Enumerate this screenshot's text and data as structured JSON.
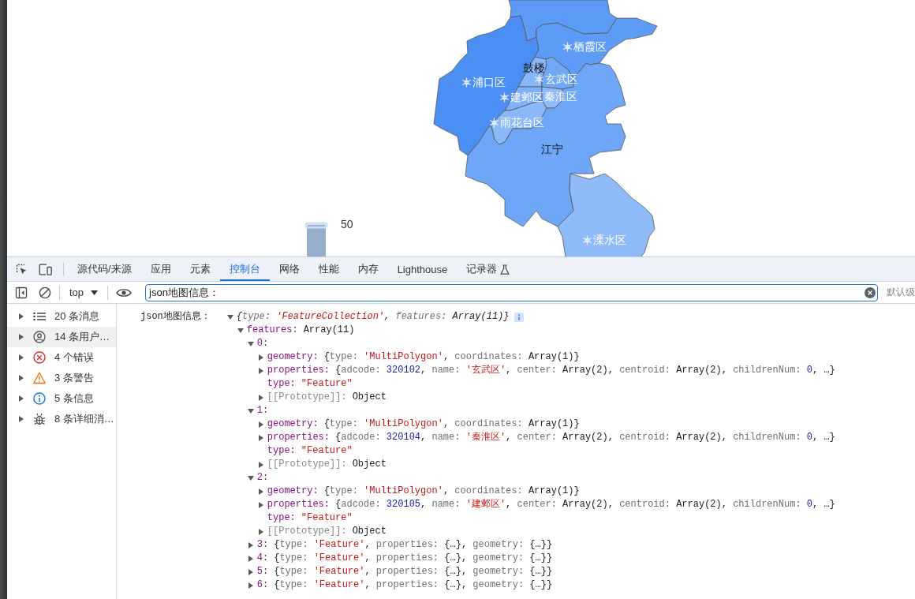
{
  "map": {
    "regions": [
      {
        "color": "#5b9bf6"
      },
      {
        "color": "#4b8ff5"
      },
      {
        "color": "#5c9cf6"
      },
      {
        "color": "#87b7f8"
      },
      {
        "color": "#6fa8f7"
      },
      {
        "color": "#7db1f8"
      },
      {
        "color": "#8dbaf8"
      },
      {
        "color": "#8ab8f8"
      },
      {
        "color": "#6ea7f7"
      },
      {
        "color": "#8fbbf8"
      }
    ],
    "labels": [
      {
        "text": "栖霞区",
        "kind": "marker",
        "icon": true
      },
      {
        "text": "浦口区",
        "kind": "marker",
        "icon": true
      },
      {
        "text": "鼓楼",
        "kind": "name",
        "icon": false
      },
      {
        "text": "玄武区",
        "kind": "marker",
        "icon": true
      },
      {
        "text": "建邺区",
        "kind": "marker",
        "icon": true
      },
      {
        "text": "秦淮区",
        "kind": "marker",
        "icon": false
      },
      {
        "text": "雨花台区",
        "kind": "marker",
        "icon": true
      },
      {
        "text": "江宁",
        "kind": "name",
        "icon": false
      },
      {
        "text": "溧水区",
        "kind": "marker",
        "icon": true
      }
    ],
    "visual_map": {
      "handle_value": "50"
    }
  },
  "devtools": {
    "tabs": [
      {
        "label": "源代码/来源",
        "selected": false,
        "experimental": false
      },
      {
        "label": "应用",
        "selected": false,
        "experimental": false
      },
      {
        "label": "元素",
        "selected": false,
        "experimental": false
      },
      {
        "label": "控制台",
        "selected": true,
        "experimental": false
      },
      {
        "label": "网络",
        "selected": false,
        "experimental": false
      },
      {
        "label": "性能",
        "selected": false,
        "experimental": false
      },
      {
        "label": "内存",
        "selected": false,
        "experimental": false
      },
      {
        "label": "Lighthouse",
        "selected": false,
        "experimental": false
      },
      {
        "label": "记录器",
        "selected": false,
        "experimental": true
      }
    ],
    "toolbar": {
      "context": "top",
      "filter": {
        "value": "json地图信息："
      },
      "levels": "默认级"
    },
    "sidebar": [
      {
        "label": "20 条消息",
        "kind": "all",
        "selected": false,
        "expanded": false
      },
      {
        "label": "14 条用户…",
        "kind": "user",
        "selected": true,
        "expanded": false
      },
      {
        "label": "4 个错误",
        "kind": "error",
        "selected": false,
        "expanded": false
      },
      {
        "label": "3 条警告",
        "kind": "warning",
        "selected": false,
        "expanded": false
      },
      {
        "label": "5 条信息",
        "kind": "info",
        "selected": false,
        "expanded": false
      },
      {
        "label": "8 条详细消…",
        "kind": "verbose",
        "selected": false,
        "expanded": false
      }
    ],
    "console": {
      "message": "json地图信息：",
      "tree": {
        "kind": "root",
        "expanded": true,
        "parts": [
          {
            "kind": "plain",
            "text": "{"
          },
          {
            "kind": "name",
            "text": "type: "
          },
          {
            "kind": "string",
            "text": "'FeatureCollection'"
          },
          {
            "kind": "plain",
            "text": ", "
          },
          {
            "kind": "name",
            "text": "features: "
          },
          {
            "kind": "plain",
            "text": "Array(11)}"
          }
        ],
        "children": [
          {
            "kind": "branch",
            "key": "features:",
            "expanded": true,
            "parts": [
              {
                "kind": "plain",
                "text": "Array(11)"
              }
            ],
            "children": [
              {
                "kind": "branch",
                "key": "0:",
                "expanded": true,
                "children": [
                  {
                    "kind": "branch",
                    "key": "geometry:",
                    "expanded": false,
                    "parts": [
                      {
                        "kind": "plain",
                        "text": "{"
                      },
                      {
                        "kind": "name",
                        "text": "type: "
                      },
                      {
                        "kind": "string",
                        "text": "'MultiPolygon'"
                      },
                      {
                        "kind": "plain",
                        "text": ", "
                      },
                      {
                        "kind": "name",
                        "text": "coordinates: "
                      },
                      {
                        "kind": "plain",
                        "text": "Array(1)}"
                      }
                    ]
                  },
                  {
                    "kind": "branch",
                    "key": "properties:",
                    "expanded": false,
                    "parts": [
                      {
                        "kind": "plain",
                        "text": "{"
                      },
                      {
                        "kind": "name",
                        "text": "adcode: "
                      },
                      {
                        "kind": "number",
                        "text": "320102"
                      },
                      {
                        "kind": "plain",
                        "text": ", "
                      },
                      {
                        "kind": "name",
                        "text": "name: "
                      },
                      {
                        "kind": "string",
                        "text": "'玄武区'"
                      },
                      {
                        "kind": "plain",
                        "text": ", "
                      },
                      {
                        "kind": "name",
                        "text": "center: "
                      },
                      {
                        "kind": "plain",
                        "text": "Array(2), "
                      },
                      {
                        "kind": "name",
                        "text": "centroid: "
                      },
                      {
                        "kind": "plain",
                        "text": "Array(2), "
                      },
                      {
                        "kind": "name",
                        "text": "childrenNum: "
                      },
                      {
                        "kind": "number",
                        "text": "0"
                      },
                      {
                        "kind": "plain",
                        "text": ", …}"
                      }
                    ]
                  },
                  {
                    "kind": "leaf",
                    "key": "type:",
                    "parts": [
                      {
                        "kind": "string",
                        "text": "\"Feature\""
                      }
                    ]
                  },
                  {
                    "kind": "internal",
                    "key": "[[Prototype]]:",
                    "expanded": false,
                    "parts": [
                      {
                        "kind": "plain",
                        "text": "Object"
                      }
                    ]
                  }
                ]
              },
              {
                "kind": "branch",
                "key": "1:",
                "expanded": true,
                "children": [
                  {
                    "kind": "branch",
                    "key": "geometry:",
                    "expanded": false,
                    "parts": [
                      {
                        "kind": "plain",
                        "text": "{"
                      },
                      {
                        "kind": "name",
                        "text": "type: "
                      },
                      {
                        "kind": "string",
                        "text": "'MultiPolygon'"
                      },
                      {
                        "kind": "plain",
                        "text": ", "
                      },
                      {
                        "kind": "name",
                        "text": "coordinates: "
                      },
                      {
                        "kind": "plain",
                        "text": "Array(1)}"
                      }
                    ]
                  },
                  {
                    "kind": "branch",
                    "key": "properties:",
                    "expanded": false,
                    "parts": [
                      {
                        "kind": "plain",
                        "text": "{"
                      },
                      {
                        "kind": "name",
                        "text": "adcode: "
                      },
                      {
                        "kind": "number",
                        "text": "320104"
                      },
                      {
                        "kind": "plain",
                        "text": ", "
                      },
                      {
                        "kind": "name",
                        "text": "name: "
                      },
                      {
                        "kind": "string",
                        "text": "'秦淮区'"
                      },
                      {
                        "kind": "plain",
                        "text": ", "
                      },
                      {
                        "kind": "name",
                        "text": "center: "
                      },
                      {
                        "kind": "plain",
                        "text": "Array(2), "
                      },
                      {
                        "kind": "name",
                        "text": "centroid: "
                      },
                      {
                        "kind": "plain",
                        "text": "Array(2), "
                      },
                      {
                        "kind": "name",
                        "text": "childrenNum: "
                      },
                      {
                        "kind": "number",
                        "text": "0"
                      },
                      {
                        "kind": "plain",
                        "text": ", …}"
                      }
                    ]
                  },
                  {
                    "kind": "leaf",
                    "key": "type:",
                    "parts": [
                      {
                        "kind": "string",
                        "text": "\"Feature\""
                      }
                    ]
                  },
                  {
                    "kind": "internal",
                    "key": "[[Prototype]]:",
                    "expanded": false,
                    "parts": [
                      {
                        "kind": "plain",
                        "text": "Object"
                      }
                    ]
                  }
                ]
              },
              {
                "kind": "branch",
                "key": "2:",
                "expanded": true,
                "children": [
                  {
                    "kind": "branch",
                    "key": "geometry:",
                    "expanded": false,
                    "parts": [
                      {
                        "kind": "plain",
                        "text": "{"
                      },
                      {
                        "kind": "name",
                        "text": "type: "
                      },
                      {
                        "kind": "string",
                        "text": "'MultiPolygon'"
                      },
                      {
                        "kind": "plain",
                        "text": ", "
                      },
                      {
                        "kind": "name",
                        "text": "coordinates: "
                      },
                      {
                        "kind": "plain",
                        "text": "Array(1)}"
                      }
                    ]
                  },
                  {
                    "kind": "branch",
                    "key": "properties:",
                    "expanded": false,
                    "parts": [
                      {
                        "kind": "plain",
                        "text": "{"
                      },
                      {
                        "kind": "name",
                        "text": "adcode: "
                      },
                      {
                        "kind": "number",
                        "text": "320105"
                      },
                      {
                        "kind": "plain",
                        "text": ", "
                      },
                      {
                        "kind": "name",
                        "text": "name: "
                      },
                      {
                        "kind": "string",
                        "text": "'建邺区'"
                      },
                      {
                        "kind": "plain",
                        "text": ", "
                      },
                      {
                        "kind": "name",
                        "text": "center: "
                      },
                      {
                        "kind": "plain",
                        "text": "Array(2), "
                      },
                      {
                        "kind": "name",
                        "text": "centroid: "
                      },
                      {
                        "kind": "plain",
                        "text": "Array(2), "
                      },
                      {
                        "kind": "name",
                        "text": "childrenNum: "
                      },
                      {
                        "kind": "number",
                        "text": "0"
                      },
                      {
                        "kind": "plain",
                        "text": ", …}"
                      }
                    ]
                  },
                  {
                    "kind": "leaf",
                    "key": "type:",
                    "parts": [
                      {
                        "kind": "string",
                        "text": "\"Feature\""
                      }
                    ]
                  },
                  {
                    "kind": "internal",
                    "key": "[[Prototype]]:",
                    "expanded": false,
                    "parts": [
                      {
                        "kind": "plain",
                        "text": "Object"
                      }
                    ]
                  }
                ]
              },
              {
                "kind": "branch",
                "key": "3:",
                "expanded": false,
                "parts": [
                  {
                    "kind": "plain",
                    "text": "{"
                  },
                  {
                    "kind": "name",
                    "text": "type: "
                  },
                  {
                    "kind": "string",
                    "text": "'Feature'"
                  },
                  {
                    "kind": "plain",
                    "text": ", "
                  },
                  {
                    "kind": "name",
                    "text": "properties: "
                  },
                  {
                    "kind": "plain",
                    "text": "{…}, "
                  },
                  {
                    "kind": "name",
                    "text": "geometry: "
                  },
                  {
                    "kind": "plain",
                    "text": "{…}}"
                  }
                ]
              },
              {
                "kind": "branch",
                "key": "4:",
                "expanded": false,
                "parts": [
                  {
                    "kind": "plain",
                    "text": "{"
                  },
                  {
                    "kind": "name",
                    "text": "type: "
                  },
                  {
                    "kind": "string",
                    "text": "'Feature'"
                  },
                  {
                    "kind": "plain",
                    "text": ", "
                  },
                  {
                    "kind": "name",
                    "text": "properties: "
                  },
                  {
                    "kind": "plain",
                    "text": "{…}, "
                  },
                  {
                    "kind": "name",
                    "text": "geometry: "
                  },
                  {
                    "kind": "plain",
                    "text": "{…}}"
                  }
                ]
              },
              {
                "kind": "branch",
                "key": "5:",
                "expanded": false,
                "parts": [
                  {
                    "kind": "plain",
                    "text": "{"
                  },
                  {
                    "kind": "name",
                    "text": "type: "
                  },
                  {
                    "kind": "string",
                    "text": "'Feature'"
                  },
                  {
                    "kind": "plain",
                    "text": ", "
                  },
                  {
                    "kind": "name",
                    "text": "properties: "
                  },
                  {
                    "kind": "plain",
                    "text": "{…}, "
                  },
                  {
                    "kind": "name",
                    "text": "geometry: "
                  },
                  {
                    "kind": "plain",
                    "text": "{…}}"
                  }
                ]
              },
              {
                "kind": "branch",
                "key": "6:",
                "expanded": false,
                "parts": [
                  {
                    "kind": "plain",
                    "text": "{"
                  },
                  {
                    "kind": "name",
                    "text": "type: "
                  },
                  {
                    "kind": "string",
                    "text": "'Feature'"
                  },
                  {
                    "kind": "plain",
                    "text": ", "
                  },
                  {
                    "kind": "name",
                    "text": "properties: "
                  },
                  {
                    "kind": "plain",
                    "text": "{…}, "
                  },
                  {
                    "kind": "name",
                    "text": "geometry: "
                  },
                  {
                    "kind": "plain",
                    "text": "{…}}"
                  }
                ]
              }
            ]
          }
        ]
      }
    }
  }
}
